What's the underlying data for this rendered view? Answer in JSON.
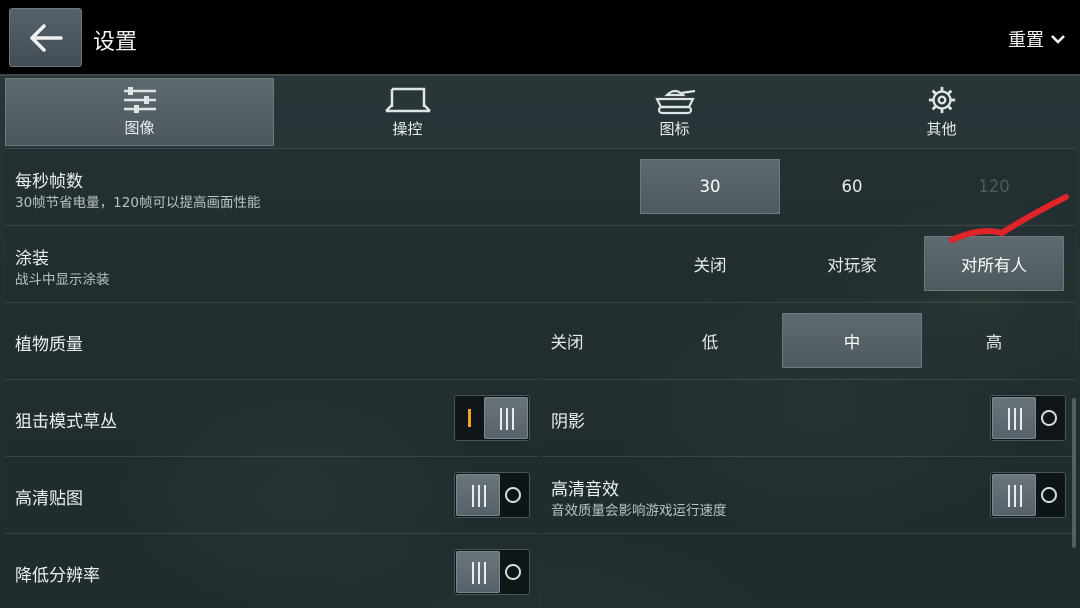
{
  "header": {
    "title": "设置",
    "reset_label": "重置"
  },
  "tabs": [
    {
      "label": "图像",
      "icon": "sliders-icon",
      "active": true
    },
    {
      "label": "操控",
      "icon": "controls-icon",
      "active": false
    },
    {
      "label": "图标",
      "icon": "tank-icon",
      "active": false
    },
    {
      "label": "其他",
      "icon": "gear-icon",
      "active": false
    }
  ],
  "fps": {
    "title": "每秒帧数",
    "subtitle": "30帧节省电量，120帧可以提高画面性能",
    "options": [
      "30",
      "60",
      "120"
    ],
    "selected": "30"
  },
  "skins": {
    "title": "涂装",
    "subtitle": "战斗中显示涂装",
    "options": [
      "关闭",
      "对玩家",
      "对所有人"
    ],
    "selected": "对所有人"
  },
  "vegetation": {
    "title": "植物质量",
    "options": [
      "关闭",
      "低",
      "中",
      "高"
    ],
    "selected": "中"
  },
  "toggles": {
    "sniper_grass": {
      "label": "狙击模式草丛",
      "on": true
    },
    "shadows": {
      "label": "阴影",
      "on": false
    },
    "hd_textures": {
      "label": "高清贴图",
      "on": false
    },
    "hd_sound": {
      "label": "高清音效",
      "sub": "音效质量会影响游戏运行速度",
      "on": false
    },
    "lower_res": {
      "label": "降低分辨率",
      "on": false
    }
  },
  "colors": {
    "accent_on": "#f0a623",
    "annotation": "#e0242a"
  }
}
